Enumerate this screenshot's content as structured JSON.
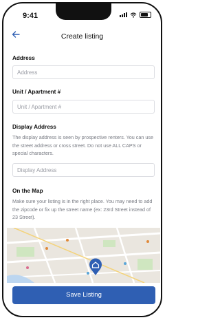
{
  "status_bar": {
    "time": "9:41"
  },
  "header": {
    "title": "Create listing",
    "back_icon": "arrow-left-icon"
  },
  "address": {
    "label": "Address",
    "placeholder": "Address"
  },
  "unit": {
    "label": "Unit / Apartment #",
    "placeholder": "Unit / Apartment #"
  },
  "display_address": {
    "label": "Display Address",
    "description": "The display address is seen by prospective renters. You can use the street address or cross street. Do not use ALL CAPS or special characters.",
    "placeholder": "Display Address"
  },
  "on_map": {
    "label": "On the Map",
    "description": "Make sure your listing is in the right place. You may need to add the zipcode or fix up the street name (ex: 23rd Street instead of 23 Street).",
    "pin_icon": "home-map-pin-icon"
  },
  "save_button": {
    "label": "Save Listing"
  },
  "colors": {
    "accent": "#2f5fb3",
    "map_bg": "#eae6df",
    "park": "#cfe6c0",
    "water": "#bcd6f0"
  }
}
